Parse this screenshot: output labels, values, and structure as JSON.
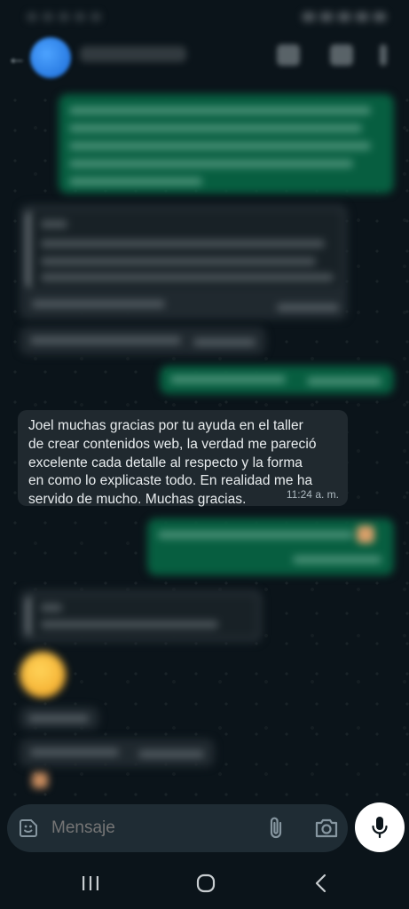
{
  "conversation": {
    "highlighted_message": {
      "text": "Joel muchas gracias por tu ayuda en el taller\nde crear contenidos web, la verdad me pareció\nexcelente cada detalle al respecto y la forma\nen como lo explicaste todo. En realidad me ha\nservido de mucho. Muchas gracias.",
      "time": "11:24 a. m."
    }
  },
  "composer": {
    "placeholder": "Mensaje",
    "sticker_icon": "sticker-icon",
    "attach_icon": "paperclip-icon",
    "camera_icon": "camera-icon",
    "mic_icon": "microphone-icon"
  },
  "colors": {
    "background": "#0b141a",
    "incoming_bubble": "#20292f",
    "outgoing_bubble": "#075e40",
    "composer_bg": "#1f2c34",
    "mic_button": "#ffffff"
  },
  "navigation": {
    "recents_icon": "recents-icon",
    "home_icon": "home-icon",
    "back_icon": "back-icon"
  }
}
